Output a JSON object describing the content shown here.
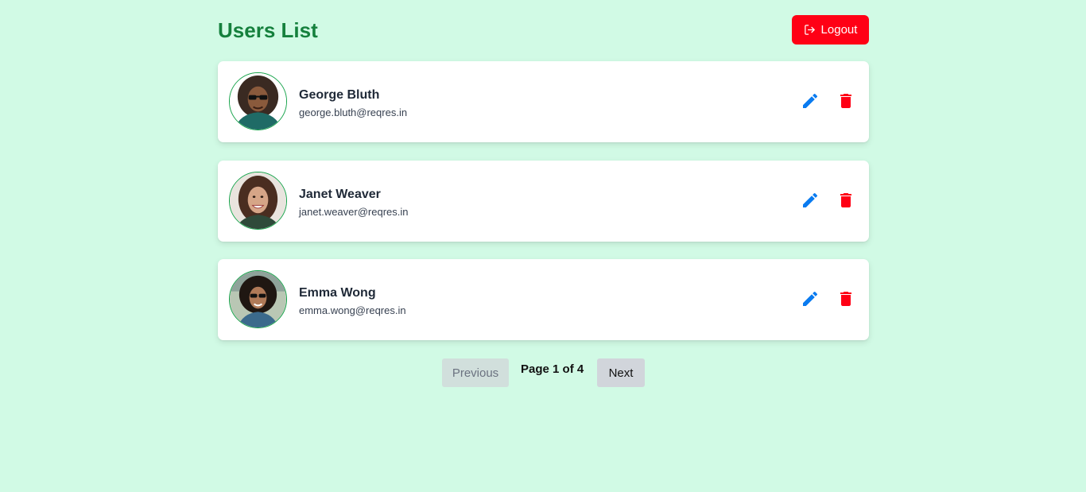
{
  "header": {
    "title": "Users List",
    "logout_label": "Logout"
  },
  "users": [
    {
      "name": "George Bluth",
      "email": "george.bluth@reqres.in"
    },
    {
      "name": "Janet Weaver",
      "email": "janet.weaver@reqres.in"
    },
    {
      "name": "Emma Wong",
      "email": "emma.wong@reqres.in"
    }
  ],
  "pagination": {
    "previous_label": "Previous",
    "page_indicator": "Page 1 of 4",
    "next_label": "Next"
  },
  "icons": {
    "logout": "logout-icon",
    "edit": "pencil-icon",
    "delete": "trash-icon",
    "avatar": "user-photo"
  },
  "colors": {
    "background": "#d1fae5",
    "title": "#15803d",
    "logout_button": "#ff0015",
    "edit_icon": "#0a7bf0",
    "delete_icon": "#ff0015",
    "avatar_border": "#16a34a"
  }
}
